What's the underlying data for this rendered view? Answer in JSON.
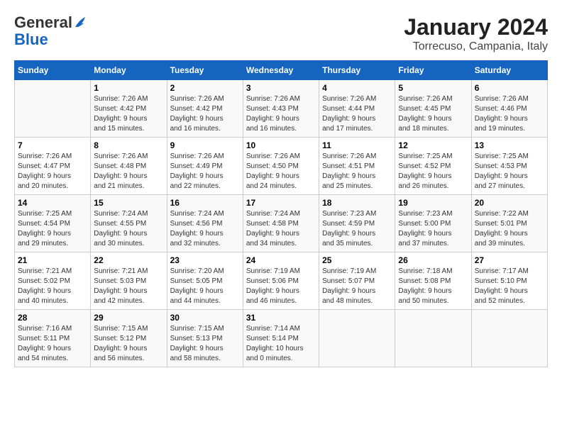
{
  "header": {
    "logo_general": "General",
    "logo_blue": "Blue",
    "title": "January 2024",
    "subtitle": "Torrecuso, Campania, Italy"
  },
  "columns": [
    "Sunday",
    "Monday",
    "Tuesday",
    "Wednesday",
    "Thursday",
    "Friday",
    "Saturday"
  ],
  "weeks": [
    [
      {
        "day": "",
        "info": ""
      },
      {
        "day": "1",
        "info": "Sunrise: 7:26 AM\nSunset: 4:42 PM\nDaylight: 9 hours\nand 15 minutes."
      },
      {
        "day": "2",
        "info": "Sunrise: 7:26 AM\nSunset: 4:42 PM\nDaylight: 9 hours\nand 16 minutes."
      },
      {
        "day": "3",
        "info": "Sunrise: 7:26 AM\nSunset: 4:43 PM\nDaylight: 9 hours\nand 16 minutes."
      },
      {
        "day": "4",
        "info": "Sunrise: 7:26 AM\nSunset: 4:44 PM\nDaylight: 9 hours\nand 17 minutes."
      },
      {
        "day": "5",
        "info": "Sunrise: 7:26 AM\nSunset: 4:45 PM\nDaylight: 9 hours\nand 18 minutes."
      },
      {
        "day": "6",
        "info": "Sunrise: 7:26 AM\nSunset: 4:46 PM\nDaylight: 9 hours\nand 19 minutes."
      }
    ],
    [
      {
        "day": "7",
        "info": "Sunrise: 7:26 AM\nSunset: 4:47 PM\nDaylight: 9 hours\nand 20 minutes."
      },
      {
        "day": "8",
        "info": "Sunrise: 7:26 AM\nSunset: 4:48 PM\nDaylight: 9 hours\nand 21 minutes."
      },
      {
        "day": "9",
        "info": "Sunrise: 7:26 AM\nSunset: 4:49 PM\nDaylight: 9 hours\nand 22 minutes."
      },
      {
        "day": "10",
        "info": "Sunrise: 7:26 AM\nSunset: 4:50 PM\nDaylight: 9 hours\nand 24 minutes."
      },
      {
        "day": "11",
        "info": "Sunrise: 7:26 AM\nSunset: 4:51 PM\nDaylight: 9 hours\nand 25 minutes."
      },
      {
        "day": "12",
        "info": "Sunrise: 7:25 AM\nSunset: 4:52 PM\nDaylight: 9 hours\nand 26 minutes."
      },
      {
        "day": "13",
        "info": "Sunrise: 7:25 AM\nSunset: 4:53 PM\nDaylight: 9 hours\nand 27 minutes."
      }
    ],
    [
      {
        "day": "14",
        "info": "Sunrise: 7:25 AM\nSunset: 4:54 PM\nDaylight: 9 hours\nand 29 minutes."
      },
      {
        "day": "15",
        "info": "Sunrise: 7:24 AM\nSunset: 4:55 PM\nDaylight: 9 hours\nand 30 minutes."
      },
      {
        "day": "16",
        "info": "Sunrise: 7:24 AM\nSunset: 4:56 PM\nDaylight: 9 hours\nand 32 minutes."
      },
      {
        "day": "17",
        "info": "Sunrise: 7:24 AM\nSunset: 4:58 PM\nDaylight: 9 hours\nand 34 minutes."
      },
      {
        "day": "18",
        "info": "Sunrise: 7:23 AM\nSunset: 4:59 PM\nDaylight: 9 hours\nand 35 minutes."
      },
      {
        "day": "19",
        "info": "Sunrise: 7:23 AM\nSunset: 5:00 PM\nDaylight: 9 hours\nand 37 minutes."
      },
      {
        "day": "20",
        "info": "Sunrise: 7:22 AM\nSunset: 5:01 PM\nDaylight: 9 hours\nand 39 minutes."
      }
    ],
    [
      {
        "day": "21",
        "info": "Sunrise: 7:21 AM\nSunset: 5:02 PM\nDaylight: 9 hours\nand 40 minutes."
      },
      {
        "day": "22",
        "info": "Sunrise: 7:21 AM\nSunset: 5:03 PM\nDaylight: 9 hours\nand 42 minutes."
      },
      {
        "day": "23",
        "info": "Sunrise: 7:20 AM\nSunset: 5:05 PM\nDaylight: 9 hours\nand 44 minutes."
      },
      {
        "day": "24",
        "info": "Sunrise: 7:19 AM\nSunset: 5:06 PM\nDaylight: 9 hours\nand 46 minutes."
      },
      {
        "day": "25",
        "info": "Sunrise: 7:19 AM\nSunset: 5:07 PM\nDaylight: 9 hours\nand 48 minutes."
      },
      {
        "day": "26",
        "info": "Sunrise: 7:18 AM\nSunset: 5:08 PM\nDaylight: 9 hours\nand 50 minutes."
      },
      {
        "day": "27",
        "info": "Sunrise: 7:17 AM\nSunset: 5:10 PM\nDaylight: 9 hours\nand 52 minutes."
      }
    ],
    [
      {
        "day": "28",
        "info": "Sunrise: 7:16 AM\nSunset: 5:11 PM\nDaylight: 9 hours\nand 54 minutes."
      },
      {
        "day": "29",
        "info": "Sunrise: 7:15 AM\nSunset: 5:12 PM\nDaylight: 9 hours\nand 56 minutes."
      },
      {
        "day": "30",
        "info": "Sunrise: 7:15 AM\nSunset: 5:13 PM\nDaylight: 9 hours\nand 58 minutes."
      },
      {
        "day": "31",
        "info": "Sunrise: 7:14 AM\nSunset: 5:14 PM\nDaylight: 10 hours\nand 0 minutes."
      },
      {
        "day": "",
        "info": ""
      },
      {
        "day": "",
        "info": ""
      },
      {
        "day": "",
        "info": ""
      }
    ]
  ]
}
